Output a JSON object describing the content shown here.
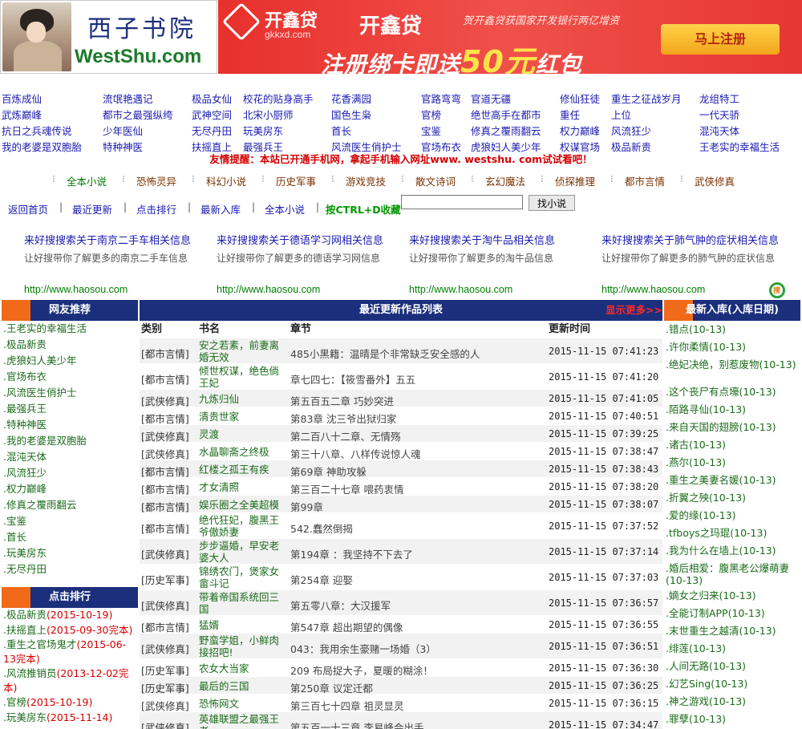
{
  "logo": {
    "cn": "西子书院",
    "en": "WestShu.com"
  },
  "banner": {
    "brand": "开鑫贷",
    "brand_en": "gkkxd.com",
    "brand2": "开鑫贷",
    "tagline": "贺开鑫贷获国家开发银行两亿增资",
    "slogan_pre": "注册绑卡即送",
    "slogan_big": "50元",
    "slogan_post": "红包",
    "register": "马上注册"
  },
  "book_links": [
    [
      "百炼成仙",
      "武炼巅峰",
      "抗日之兵魂传说",
      "我的老婆是双胞胎"
    ],
    [
      "流氓艳遇记",
      "都市之最强纵绔",
      "少年医仙",
      "特种神医"
    ],
    [
      "极品女仙",
      "武神空间",
      "无尽丹田",
      "扶摇直上"
    ],
    [
      "校花的贴身高手",
      "北宋小厨师",
      "玩美房东",
      "最强兵王"
    ],
    [
      "花香满园",
      "国色生枭",
      "首长",
      "风流医生俏护士"
    ],
    [
      "官路弯弯",
      "官榜",
      "宝鉴",
      "官场布衣"
    ],
    [
      "官道无疆",
      "绝世高手在都市",
      "修真之覆雨翻云",
      "虎狼妇人美少年"
    ],
    [
      "修仙狂徒",
      "重任",
      "权力巅峰",
      "权谋官场"
    ],
    [
      "重生之征战岁月",
      "上位",
      "风流狂少",
      "极品新贵"
    ],
    [
      "龙组特工",
      "一代天骄",
      "混沌天体",
      "王老实的幸福生活"
    ]
  ],
  "notice": "友情提醒：本站已开通手机网，拿起手机输入网址www. westshu. com试试看吧！",
  "categories": [
    "全本小说",
    "恐怖灵异",
    "科幻小说",
    "历史军事",
    "游戏竞技",
    "散文诗词",
    "玄幻魔法",
    "侦探推理",
    "都市言情",
    "武侠修真"
  ],
  "toolbar": {
    "home": "返回首页",
    "latest": "最近更新",
    "ranking": "点击排行",
    "newest": "最新入库",
    "complete": "全本小说",
    "hint": "按CTRL+D收藏",
    "search_value": "",
    "search_button": "找小说"
  },
  "ads": [
    {
      "title": "来好搜搜索关于南京二手车相关信息",
      "desc": "让好搜带你了解更多的南京二手车信息",
      "url": "http://www.haosou.com"
    },
    {
      "title": "来好搜搜索关于德语学习网相关信息",
      "desc": "让好搜带你了解更多的德语学习网信息",
      "url": "http://www.haosou.com"
    },
    {
      "title": "来好搜搜索关于淘牛品相关信息",
      "desc": "让好搜带你了解更多的淘牛品信息",
      "url": "http://www.haosou.com"
    },
    {
      "title": "来好搜搜索关于肺气肿的症状相关信息",
      "desc": "让好搜带你了解更多的肺气肿的症状信息",
      "url": "http://www.haosou.com"
    }
  ],
  "haosou_logo": "搜",
  "left": {
    "recommend_title": "网友推荐",
    "recommend": [
      ".王老实的幸福生活",
      ".极品新贵",
      ".虎狼妇人美少年",
      ".官场布衣",
      ".风流医生俏护士",
      ".最强兵王",
      ".特种神医",
      ".我的老婆是双胞胎",
      ".混沌天体",
      ".风流狂少",
      ".权力巅峰",
      ".修真之覆雨翻云",
      ".宝鉴",
      ".首长",
      ".玩美房东",
      ".无尽丹田"
    ],
    "clicks_title": "点击排行",
    "clicks": [
      {
        "name": ".极品新贵",
        "date": "(2015-10-19)"
      },
      {
        "name": ".扶摇直上",
        "date": "(2015-09-30完本)"
      },
      {
        "name": ".重生之官场鬼才",
        "date": "(2015-06-13完本)"
      },
      {
        "name": ".风流推销员",
        "date": "(2013-12-02完本)"
      },
      {
        "name": ".官榜",
        "date": "(2015-10-19)"
      },
      {
        "name": ".玩美房东",
        "date": "(2015-11-14)"
      }
    ]
  },
  "main": {
    "title": "最近更新作品列表",
    "more": "显示更多>>",
    "cols": {
      "cat": "类别",
      "book": "书名",
      "chap": "章节",
      "time": "更新时间"
    },
    "rows": [
      {
        "cat": "[都市言情]",
        "book": "安之若素，前妻离婚无效",
        "chap": "485小黑籍：温晴是个非常缺乏安全感的人",
        "time": "2015-11-15 07:41:23",
        "h": 32
      },
      {
        "cat": "[都市言情]",
        "book": "倾世权谋，绝色倘王妃",
        "chap": "章七四七：【筱雪番外】五五",
        "time": "2015-11-15 07:41:20",
        "h": 32
      },
      {
        "cat": "[武侠修真]",
        "book": "九炼归仙",
        "chap": "第五百五二章 巧妙突进",
        "time": "2015-11-15 07:41:05",
        "h": 22
      },
      {
        "cat": "[都市言情]",
        "book": "清贵世家",
        "chap": "第83章 沈三爷出狱归家",
        "time": "2015-11-15 07:40:51",
        "h": 22
      },
      {
        "cat": "[武侠修真]",
        "book": "灵渡",
        "chap": "第二百八十二章、无情殇",
        "time": "2015-11-15 07:39:25",
        "h": 22
      },
      {
        "cat": "[武侠修真]",
        "book": "水晶聊斋之终极",
        "chap": "第三十八章、八样传说惊人魂",
        "time": "2015-11-15 07:38:47",
        "h": 22
      },
      {
        "cat": "[都市言情]",
        "book": "红楼之孤王有疾",
        "chap": "第69章 神助攻躲",
        "time": "2015-11-15 07:38:43",
        "h": 22
      },
      {
        "cat": "[都市言情]",
        "book": "才女清照",
        "chap": "第三百二十七章 喂药衷情",
        "time": "2015-11-15 07:38:20",
        "h": 22
      },
      {
        "cat": "[都市言情]",
        "book": "娱乐圈之全美超模",
        "chap": "第99章",
        "time": "2015-11-15 07:38:07",
        "h": 22
      },
      {
        "cat": "[都市言情]",
        "book": "绝代狂妃，腹黑王爷傲娇妻",
        "chap": "542.蠢然倒揭",
        "time": "2015-11-15 07:37:52",
        "h": 32
      },
      {
        "cat": "[武侠修真]",
        "book": "步步逼婚，早安老婆大人",
        "chap": "第194章 ：我坚持不下去了",
        "time": "2015-11-15 07:37:14",
        "h": 32
      },
      {
        "cat": "[历史军事]",
        "book": "锦绣农门，煲家女畲斗记",
        "chap": "第254章 迎娶",
        "time": "2015-11-15 07:37:03",
        "h": 32
      },
      {
        "cat": "[武侠修真]",
        "book": "带着帝国系统回三国",
        "chap": "第五零八章：大汉援军",
        "time": "2015-11-15 07:36:57",
        "h": 32
      },
      {
        "cat": "[都市言情]",
        "book": "猛婿",
        "chap": "第547章 超出期望的偶像",
        "time": "2015-11-15 07:36:55",
        "h": 22
      },
      {
        "cat": "[武侠修真]",
        "book": "野蛮学姐，小鲜肉接招吧!",
        "chap": "043：我用余生豪赌一场婚（3）",
        "time": "2015-11-15 07:36:51",
        "h": 32
      },
      {
        "cat": "[历史军事]",
        "book": "农女大当家",
        "chap": "209 布局捉大子，夏暖的糊涂！",
        "time": "2015-11-15 07:36:30",
        "h": 22
      },
      {
        "cat": "[历史军事]",
        "book": "最后的三国",
        "chap": "第250章 议定迁都",
        "time": "2015-11-15 07:36:25",
        "h": 22
      },
      {
        "cat": "[武侠修真]",
        "book": "恐怖网文",
        "chap": "第三百七十四章 祖灵显灵",
        "time": "2015-11-15 07:36:15",
        "h": 22
      },
      {
        "cat": "[武侠修真]",
        "book": "英雄联盟之最强王者",
        "chap": "第五百一十三章 李易峰会出手",
        "time": "2015-11-15 07:34:47",
        "h": 32
      }
    ]
  },
  "right": {
    "title": "最新入库(入库日期)",
    "items": [
      ".错点(10-13)",
      ".许你柔情(10-13)",
      ".绝妃决绝，别惹废物(10-13)",
      ".这个丧尸有点壕(10-13)",
      ".陌路寻仙(10-13)",
      ".来自天国的翅膀(10-13)",
      ".诸古(10-13)",
      ".燕尔(10-13)",
      ".重生之美妻名媛(10-13)",
      ".折翼之殃(10-13)",
      ".爱的缘(10-13)",
      ".tfboys之玛琨(10-13)",
      ".我为什么在墙上(10-13)",
      ".婚后相爱：腹黑老公爆萌妻(10-13)",
      ".嫡女之归来(10-13)",
      ".全能订制APP(10-13)",
      ".末世重生之越清(10-13)",
      ".绯莲(10-13)",
      ".人间无路(10-13)",
      ".幻艺Sing(10-13)",
      ".神之游戏(10-13)",
      ".罪孽(10-13)"
    ]
  }
}
